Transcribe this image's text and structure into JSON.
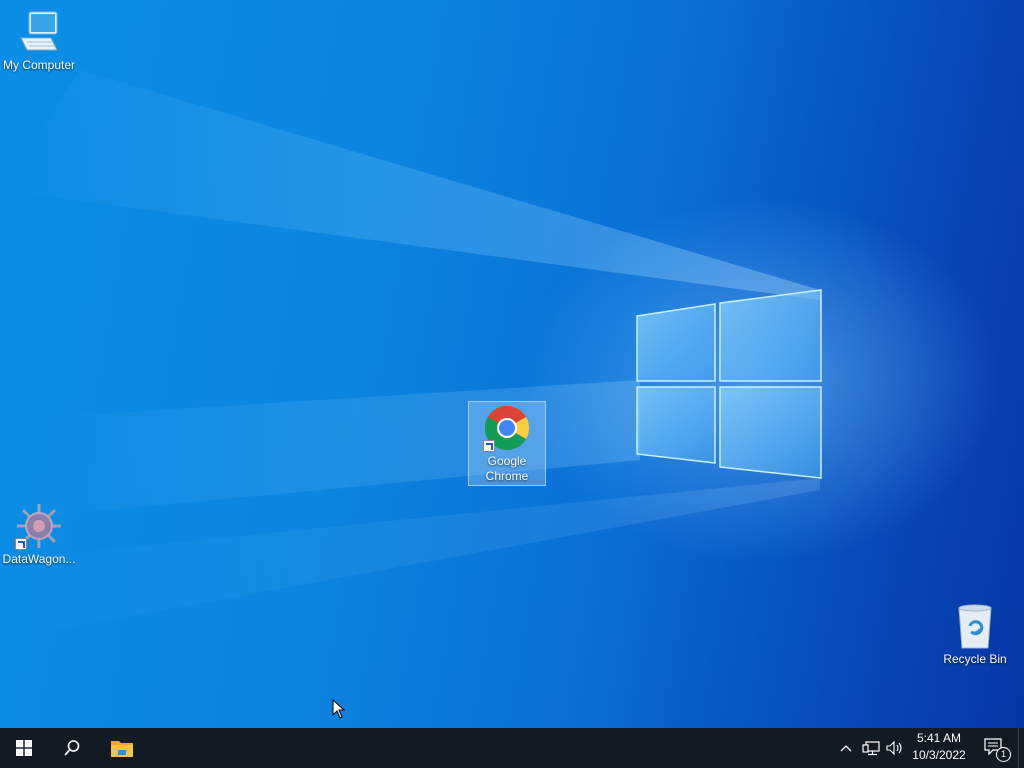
{
  "desktop": {
    "icons": [
      {
        "label": "My Computer",
        "icon": "computer-icon"
      },
      {
        "label": "Google Chrome",
        "icon": "chrome-icon",
        "selected": true
      },
      {
        "label": "DataWagon...",
        "icon": "datawagon-icon"
      },
      {
        "label": "Recycle Bin",
        "icon": "recycle-bin-icon"
      }
    ]
  },
  "taskbar": {
    "start": "windows-start-icon",
    "search": "search-icon",
    "pinned": [
      {
        "icon": "file-explorer-icon"
      }
    ],
    "tray": {
      "icons": [
        "chevron-up-icon",
        "network-icon",
        "volume-icon"
      ],
      "time": "5:41 AM",
      "date": "10/3/2022",
      "notification_count": "1"
    }
  },
  "colors": {
    "desktop_blue": "#0a8ee6",
    "taskbar": "#121a24",
    "accent": "#0078d7"
  }
}
